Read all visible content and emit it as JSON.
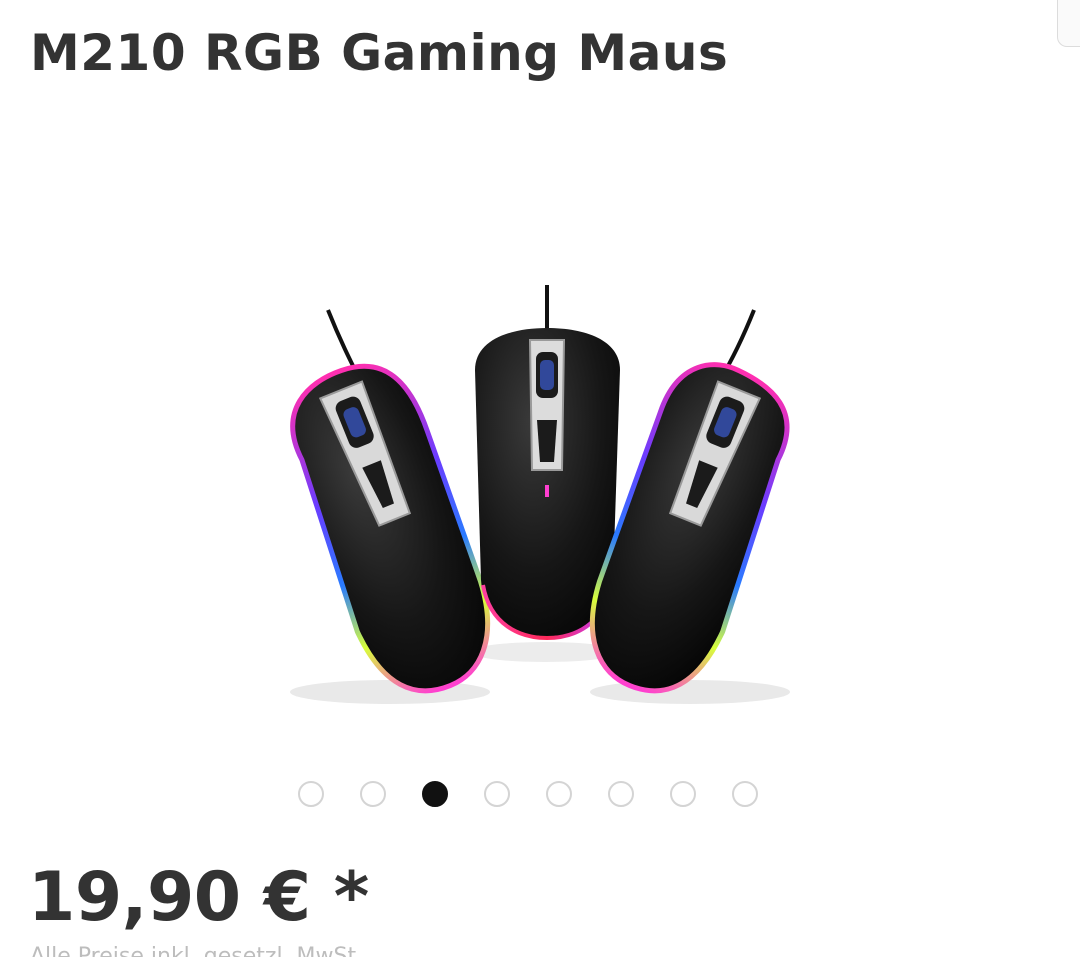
{
  "product": {
    "title": "M210 RGB Gaming Maus",
    "image_alt": "RGB gaming mouse shown in three views",
    "price": "19,90 € *",
    "price_note": "Alle Preise inkl. gesetzl. MwSt."
  },
  "gallery": {
    "total_slides": 8,
    "active_index": 2
  },
  "colors": {
    "text": "#333333",
    "active_dot": "#111111",
    "inactive_dot_border": "#d4d4d4"
  }
}
